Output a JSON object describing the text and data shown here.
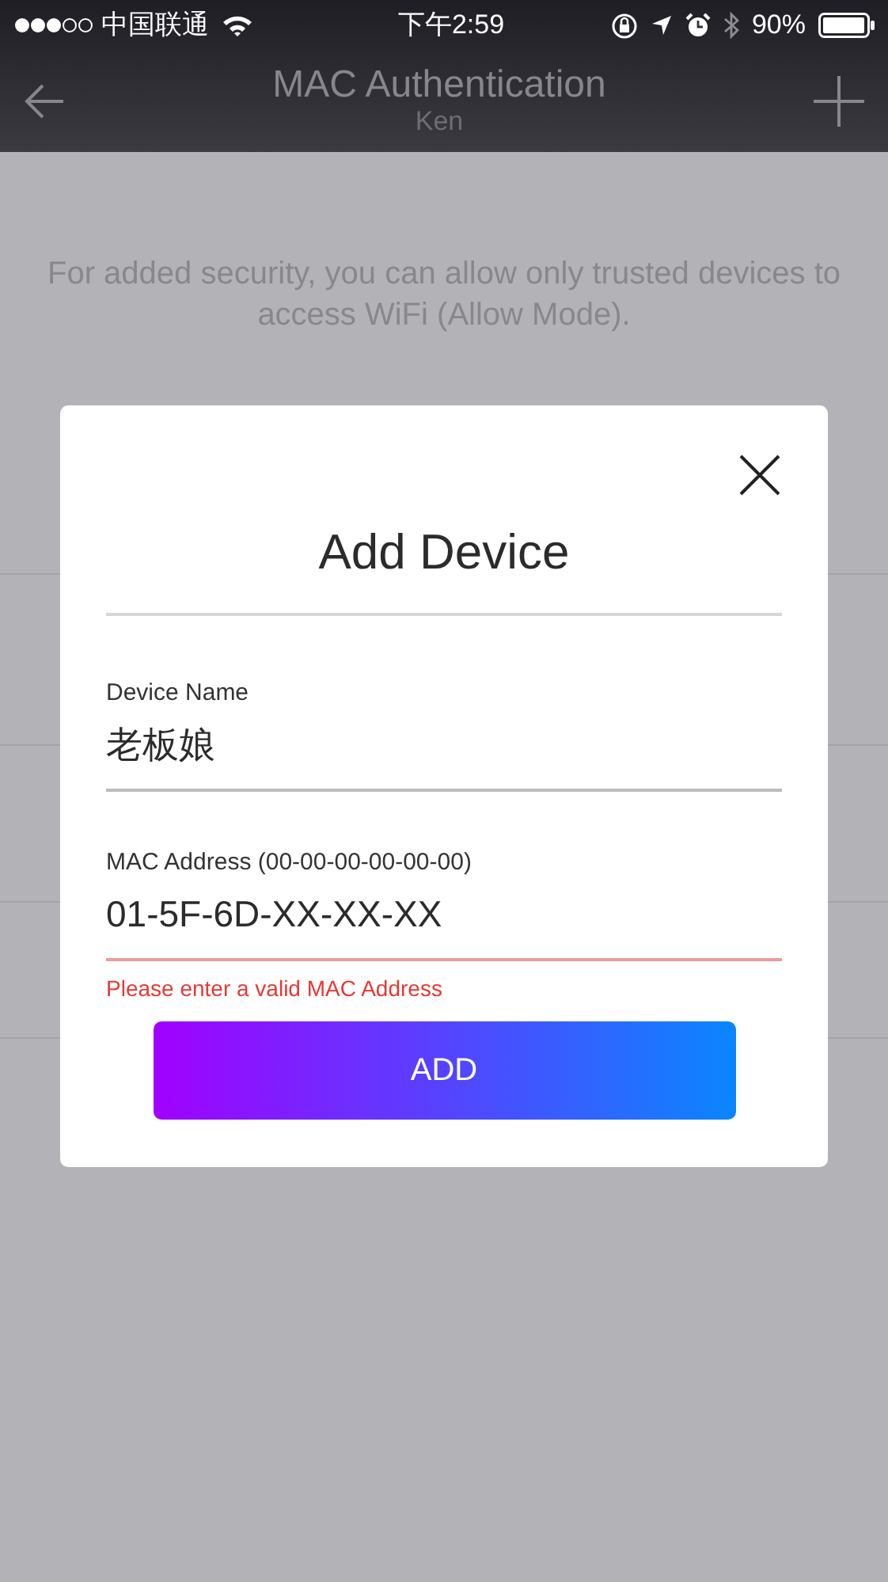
{
  "status_bar": {
    "carrier": "中国联通",
    "time": "下午2:59",
    "battery": "90%"
  },
  "header": {
    "title": "MAC Authentication",
    "subtitle": "Ken"
  },
  "description": "For added security, you can allow only trusted devices to access WiFi (Allow Mode).",
  "dialog": {
    "title": "Add Device",
    "fields": [
      {
        "label": "Device Name",
        "value": "老板娘",
        "invalid": false
      },
      {
        "label": "MAC Address (00-00-00-00-00-00)",
        "value": "01-5F-6D-XX-XX-XX",
        "invalid": true,
        "error": "Please enter a valid MAC Address"
      }
    ],
    "button": "ADD"
  }
}
